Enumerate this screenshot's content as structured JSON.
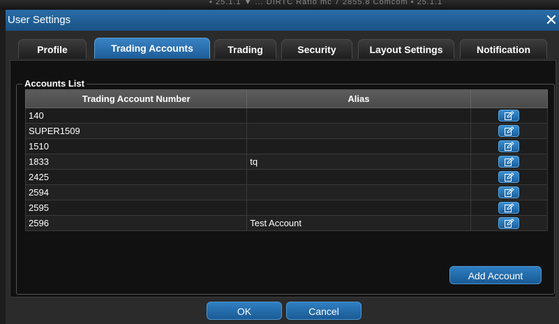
{
  "window": {
    "title": "User Settings",
    "close_glyph": "✕"
  },
  "background_text": "▪ 25.1.1 ▼ ... DIRTC Ratio mc 7 2855.8 Comcom ▪ 25.1.1",
  "tabs": [
    {
      "label": "Profile",
      "active": false
    },
    {
      "label": "Trading Accounts",
      "active": true
    },
    {
      "label": "Trading",
      "active": false
    },
    {
      "label": "Security",
      "active": false
    },
    {
      "label": "Layout Settings",
      "active": false
    },
    {
      "label": "Notification",
      "active": false
    }
  ],
  "accounts_list": {
    "legend": "Accounts List",
    "columns": [
      "Trading Account Number",
      "Alias",
      ""
    ],
    "rows": [
      {
        "account": "140",
        "alias": ""
      },
      {
        "account": "SUPER1509",
        "alias": ""
      },
      {
        "account": "1510",
        "alias": ""
      },
      {
        "account": "1833",
        "alias": "tq"
      },
      {
        "account": "2425",
        "alias": ""
      },
      {
        "account": "2594",
        "alias": ""
      },
      {
        "account": "2595",
        "alias": ""
      },
      {
        "account": "2596",
        "alias": "Test Account"
      }
    ],
    "edit_icon": "edit-icon"
  },
  "buttons": {
    "add_account": "Add Account",
    "ok": "OK",
    "cancel": "Cancel"
  },
  "colors": {
    "accent": "#1c5d99",
    "titlebar": "#1a5286",
    "panel_bg": "#111111"
  }
}
